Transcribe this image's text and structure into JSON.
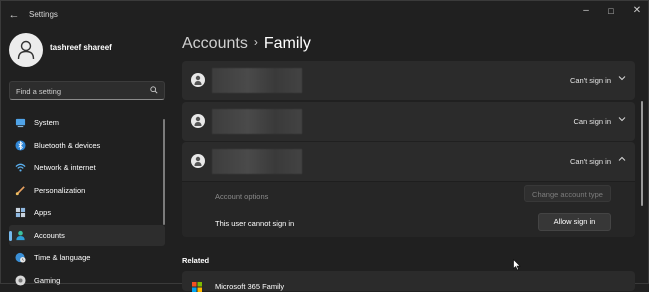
{
  "window": {
    "title": "Settings",
    "back_icon": "arrow-left-icon",
    "controls": {
      "minimize": "–",
      "maximize": "□",
      "close": "✕"
    }
  },
  "profile": {
    "name": "tashreef shareef",
    "avatar_icon": "person-icon"
  },
  "search": {
    "placeholder": "Find a setting",
    "icon": "search-icon"
  },
  "sidebar": {
    "items": [
      {
        "label": "System",
        "icon": "monitor-icon",
        "active": false
      },
      {
        "label": "Bluetooth & devices",
        "icon": "bluetooth-icon",
        "active": false
      },
      {
        "label": "Network & internet",
        "icon": "wifi-icon",
        "active": false
      },
      {
        "label": "Personalization",
        "icon": "paintbrush-icon",
        "active": false
      },
      {
        "label": "Apps",
        "icon": "apps-grid-icon",
        "active": false
      },
      {
        "label": "Accounts",
        "icon": "account-icon",
        "active": true
      },
      {
        "label": "Time & language",
        "icon": "globe-clock-icon",
        "active": false
      },
      {
        "label": "Gaming",
        "icon": "gamepad-icon",
        "active": false
      }
    ]
  },
  "breadcrumb": {
    "parent": "Accounts",
    "separator": "›",
    "current": "Family"
  },
  "family_members": [
    {
      "status": "Can't sign in",
      "expanded": false
    },
    {
      "status": "Can sign in",
      "expanded": false
    },
    {
      "status": "Can't sign in",
      "expanded": true
    }
  ],
  "expanded_options": {
    "account_options_label": "Account options",
    "change_account_type_button": "Change account type",
    "sign_in_status_label": "This user cannot sign in",
    "allow_sign_in_button": "Allow sign in"
  },
  "related": {
    "heading": "Related",
    "item_label": "Microsoft 365 Family"
  },
  "colors": {
    "background": "#202020",
    "card": "#2b2b2b",
    "accent": "#76b9ed"
  }
}
